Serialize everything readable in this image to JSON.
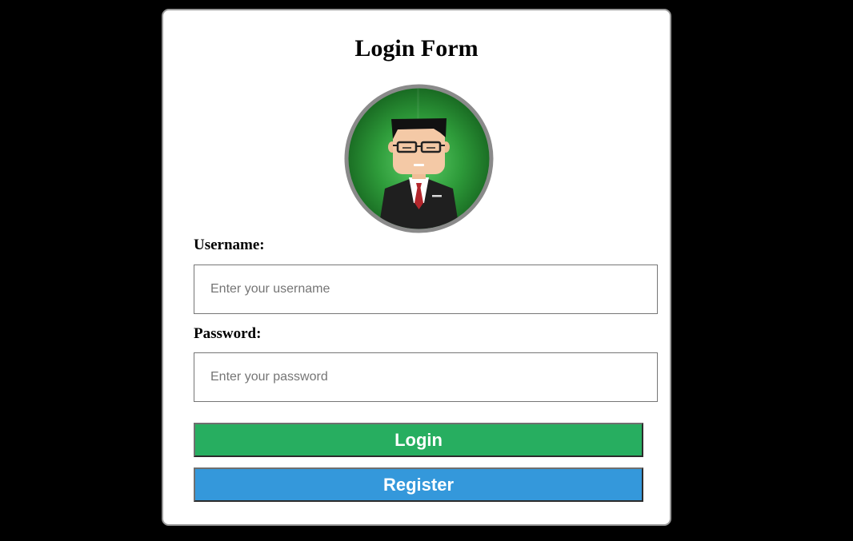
{
  "form": {
    "title": "Login Form",
    "avatar": {
      "icon": "businessman-avatar-icon",
      "ring_color": "#8a8a8a",
      "background_color": "#2e9b3a"
    },
    "username": {
      "label": "Username:",
      "placeholder": "Enter your username",
      "value": ""
    },
    "password": {
      "label": "Password:",
      "placeholder": "Enter your password",
      "value": ""
    },
    "login_button": {
      "label": "Login",
      "color": "#27ae60"
    },
    "register_button": {
      "label": "Register",
      "color": "#3498db"
    }
  }
}
